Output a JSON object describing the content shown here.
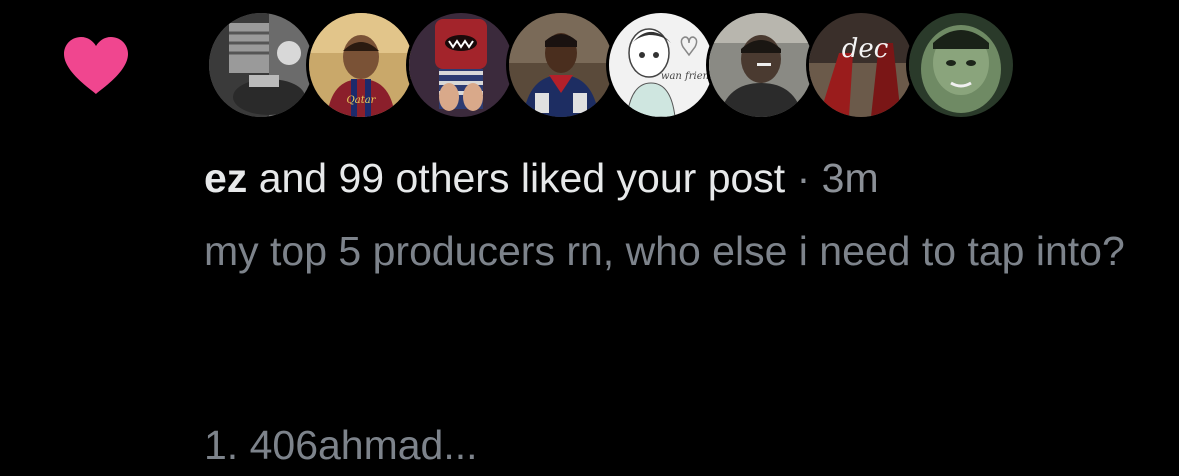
{
  "notification": {
    "type_icon": "heart-icon",
    "icon_color": "#f0468f",
    "avatars": [
      {
        "name": "avatar-1-icon",
        "caption": ""
      },
      {
        "name": "avatar-2-icon",
        "caption": "Qatar"
      },
      {
        "name": "avatar-3-icon",
        "caption": ""
      },
      {
        "name": "avatar-4-icon",
        "caption": ""
      },
      {
        "name": "avatar-5-icon",
        "caption": "wan frien"
      },
      {
        "name": "avatar-6-icon",
        "caption": ""
      },
      {
        "name": "avatar-7-icon",
        "caption": "dec"
      },
      {
        "name": "avatar-8-icon",
        "caption": ""
      }
    ],
    "actor": "ez",
    "action_text": " and 99 others liked your post",
    "separator": " · ",
    "time": "3m",
    "post_text": "my top 5 producers rn, who else i need to tap into?",
    "post_text_line2": "1. 406ahmad..."
  }
}
